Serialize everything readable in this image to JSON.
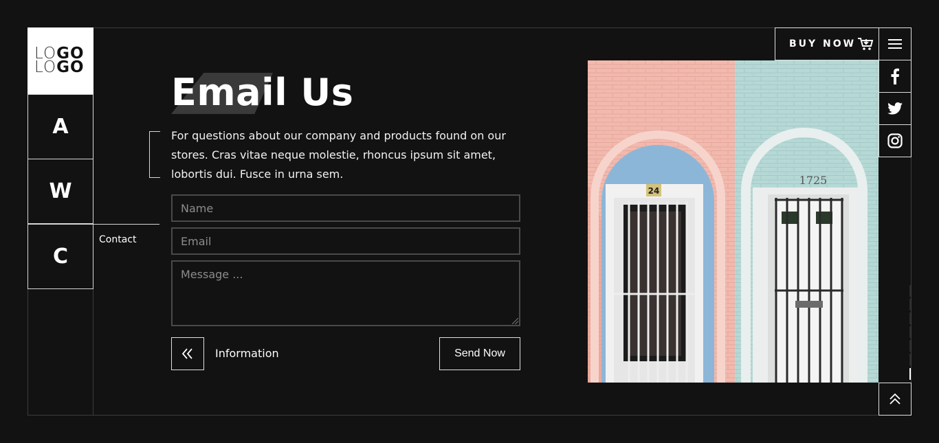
{
  "logo": {
    "line1_light": "LO",
    "line1_bold": "GO",
    "line2_light": "LO",
    "line2_bold": "GO"
  },
  "nav": {
    "items": [
      {
        "label": "A"
      },
      {
        "label": "W"
      },
      {
        "label": "C"
      }
    ],
    "active_label": "Contact"
  },
  "header": {
    "buy_label": "BUY NOW"
  },
  "main": {
    "title": "Email Us",
    "description": "For questions about our company and products found on our stores. Cras vitae neque molestie, rhoncus ipsum sit amet, lobortis dui. Fusce in urna sem.",
    "form": {
      "name_placeholder": "Name",
      "email_placeholder": "Email",
      "message_placeholder": "Message ..."
    },
    "back_label": "Information",
    "send_label": "Send Now"
  },
  "photo": {
    "left_door_number": "24",
    "right_door_number": "1725"
  },
  "icons": {
    "cart": "cart-icon",
    "menu": "hamburger-menu-icon",
    "facebook": "facebook-icon",
    "twitter": "twitter-icon",
    "instagram": "instagram-icon",
    "back": "double-chevron-left-icon",
    "up": "double-chevron-up-icon"
  },
  "colors": {
    "background": "#121212",
    "text": "#ffffff",
    "border": "#e0e0e0",
    "title_accent": "#3a3a3a"
  }
}
